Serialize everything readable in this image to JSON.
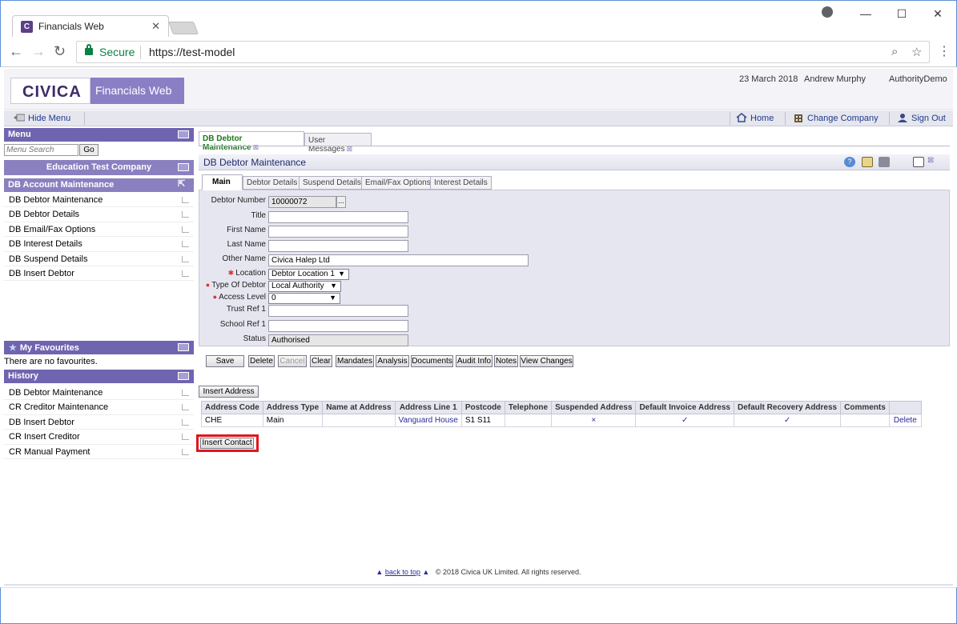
{
  "browser": {
    "tab_title": "Financials Web",
    "tab_favicon_letter": "C",
    "secure_label": "Secure",
    "url": "https://test-model"
  },
  "header": {
    "logo": "CIVICA",
    "product": "Financials Web",
    "date": "23 March 2018",
    "user": "Andrew Murphy",
    "authority": "AuthorityDemo"
  },
  "menubar": {
    "hide_menu": "Hide Menu",
    "home": "Home",
    "change_company": "Change Company",
    "sign_out": "Sign Out"
  },
  "sidebar": {
    "menu_title": "Menu",
    "search_placeholder": "Menu Search",
    "go_label": "Go",
    "company": "Education Test Company",
    "section_title": "DB Account Maintenance",
    "items": [
      {
        "label": "DB Debtor Maintenance"
      },
      {
        "label": "DB Debtor Details"
      },
      {
        "label": "DB Email/Fax Options"
      },
      {
        "label": "DB Interest Details"
      },
      {
        "label": "DB Suspend Details"
      },
      {
        "label": "DB Insert Debtor"
      }
    ],
    "favourites_title": "My Favourites",
    "favourites_empty": "There are no favourites.",
    "history_title": "History",
    "history": [
      {
        "label": "DB Debtor Maintenance"
      },
      {
        "label": "CR Creditor Maintenance"
      },
      {
        "label": "DB Insert Debtor"
      },
      {
        "label": "CR Insert Creditor"
      },
      {
        "label": "CR Manual Payment"
      }
    ]
  },
  "main": {
    "tabs": [
      {
        "label": "DB Debtor Maintenance"
      },
      {
        "label": "User Messages"
      }
    ],
    "panel_title": "DB Debtor Maintenance",
    "subtabs": [
      "Main",
      "Debtor Details",
      "Suspend Details",
      "Email/Fax Options",
      "Interest Details"
    ],
    "form": {
      "debtor_number_label": "Debtor Number",
      "debtor_number": "10000072",
      "dots": "...",
      "title_label": "Title",
      "title": "",
      "first_name_label": "First Name",
      "first_name": "",
      "last_name_label": "Last Name",
      "last_name": "",
      "other_name_label": "Other Name",
      "other_name": "Civica Halep Ltd",
      "location_label": "Location",
      "location": "Debtor Location 1",
      "type_label": "Type Of Debtor",
      "type": "Local Authority",
      "access_label": "Access Level",
      "access": "0",
      "trust_label": "Trust Ref 1",
      "trust": "",
      "school_label": "School Ref 1",
      "school": "",
      "status_label": "Status",
      "status": "Authorised"
    },
    "buttons": {
      "save": "Save",
      "delete": "Delete",
      "cancel": "Cancel",
      "clear": "Clear",
      "mandates": "Mandates",
      "analysis": "Analysis",
      "documents": "Documents",
      "audit": "Audit Info",
      "notes": "Notes",
      "view_changes": "View Changes"
    },
    "insert_address": "Insert Address",
    "insert_contact": "Insert Contact",
    "address_table": {
      "headers": [
        "Address Code",
        "Address Type",
        "Name at Address",
        "Address Line 1",
        "Postcode",
        "Telephone",
        "Suspended Address",
        "Default Invoice Address",
        "Default Recovery Address",
        "Comments",
        ""
      ],
      "row": {
        "code": "CHE",
        "type": "Main",
        "name": "",
        "line1": "Vanguard House",
        "postcode": "S1 S11",
        "telephone": "",
        "suspended": "×",
        "default_invoice": "✓",
        "default_recovery": "✓",
        "comments": "",
        "action": "Delete"
      }
    }
  },
  "footer": {
    "back_to_top": "back to top",
    "copyright": "© 2018 Civica UK Limited. All rights reserved."
  }
}
